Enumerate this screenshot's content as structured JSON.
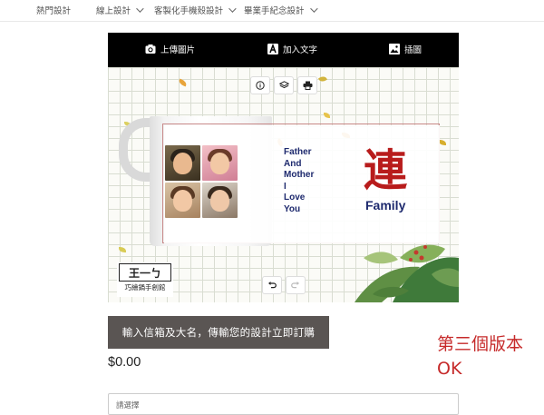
{
  "nav": {
    "items": [
      {
        "label": "熱門設計"
      },
      {
        "label": "線上設計"
      },
      {
        "label": "客製化手機殼設計"
      },
      {
        "label": "畢業手紀念設計"
      }
    ]
  },
  "toolbar": {
    "upload_label": "上傳圖片",
    "text_label": "加入文字",
    "image_label": "插圖"
  },
  "design": {
    "message_lines": [
      "Father",
      "And",
      "Mother",
      "I",
      "Love",
      "You"
    ],
    "big_char": "連",
    "family_text": "Family",
    "logo_main": "王一ㄅ",
    "logo_sub": "巧繪鍋手創館"
  },
  "order": {
    "button_label": "輸入信箱及大名，傳輸您的設計立即訂購",
    "price": "$0.00",
    "select_placeholder": "請選擇"
  },
  "annotation": {
    "line1": "第三個版本",
    "line2": "OK"
  },
  "colors": {
    "toolbar_bg": "#000000",
    "order_button_bg": "#5a5553",
    "accent_red": "#b81c1c",
    "navy_text": "#1e2a6e",
    "annotation_red": "#c62a2a"
  }
}
